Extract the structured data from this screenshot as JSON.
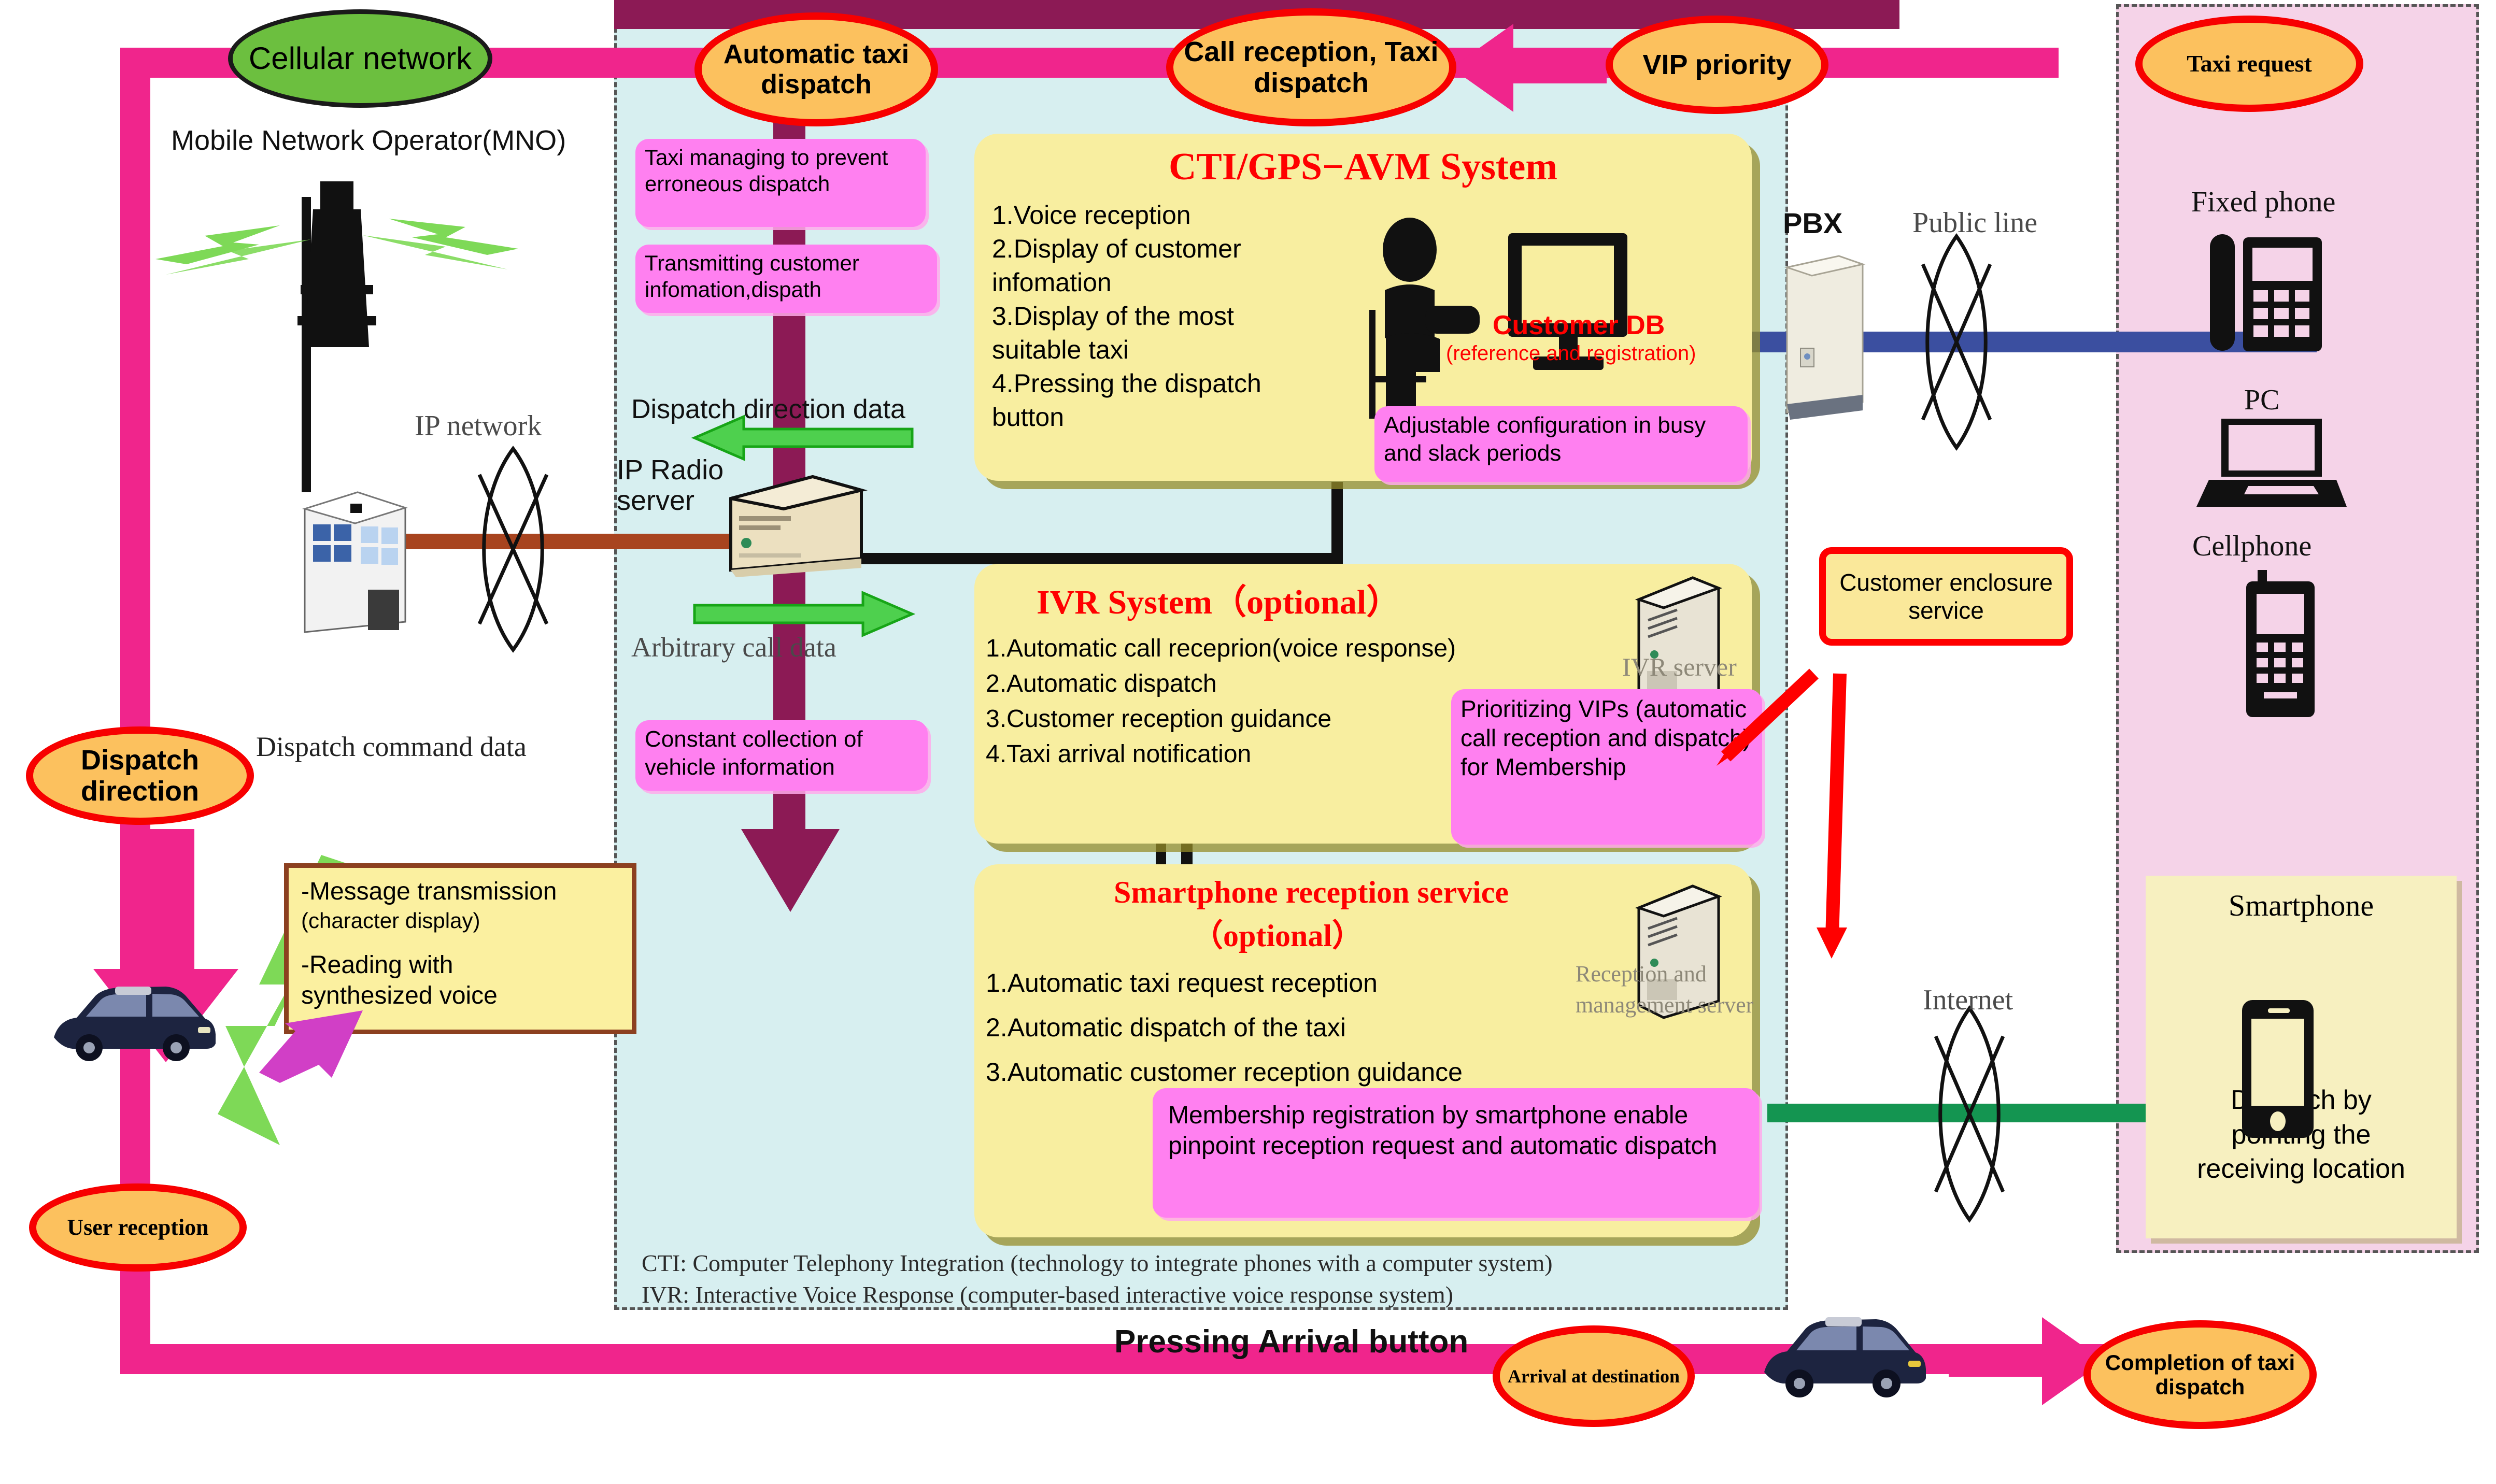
{
  "zones": {
    "center_label": "",
    "right_label": ""
  },
  "callouts": {
    "cellular_network": "Cellular network",
    "automatic_taxi_dispatch": "Automatic taxi dispatch",
    "call_reception_taxi_dispatch": "Call reception, Taxi dispatch",
    "vip_priority": "VIP priority",
    "taxi_request": "Taxi request",
    "dispatch_direction": "Dispatch direction",
    "user_reception": "User reception",
    "arrival_at_destination": "Arrival at destination",
    "completion_of_taxi_dispatch": "Completion of taxi dispatch",
    "customer_enclosure_service": "Customer enclosure service"
  },
  "labels": {
    "mno": "Mobile Network Operator(MNO)",
    "ip_network": "IP network",
    "ip_radio_server": "IP Radio server",
    "dispatch_direction_data": "Dispatch direction data",
    "arbitrary_call_data": "Arbitrary call data",
    "dispatch_command_data": "Dispatch command data",
    "pbx": "PBX",
    "public_line": "Public line",
    "internet": "Internet",
    "fixed_phone": "Fixed phone",
    "pc": "PC",
    "cellphone": "Cellphone",
    "ivr_server": "IVR server",
    "reception_management_server_line1": "Reception and",
    "reception_management_server_line2": "management server",
    "pressing_arrival_button": "Pressing Arrival button"
  },
  "notes": {
    "taxi_managing": "Taxi managing to prevent erroneous dispatch",
    "transmitting_customer": "Transmitting customer infomation,dispath",
    "constant_collection": "Constant collection of vehicle information",
    "adjustable_configuration": "Adjustable configuration in busy and slack periods",
    "prioritizing_vips": "Prioritizing VIPs (automatic call reception and dispatch) for Membership",
    "membership_registration": "Membership registration by smartphone enable pinpoint reception request and automatic dispatch"
  },
  "taxi_device_box": {
    "line1": "-Message transmission",
    "line2": "(character display)",
    "line3": "-Reading with",
    "line4": "   synthesized voice"
  },
  "cti_panel": {
    "title": "CTI/GPS−AVM System",
    "items": [
      "1.Voice reception",
      "2.Display of customer",
      "   infomation",
      "3.Display of the most",
      "   suitable taxi",
      "4.Pressing the dispatch",
      "   button"
    ],
    "customer_db": "Customer DB",
    "customer_db_sub": "(reference and registration)"
  },
  "ivr_panel": {
    "title": "IVR System（optional）",
    "items": [
      "1.Automatic call receprion(voice response)",
      "2.Automatic dispatch",
      "3.Customer reception guidance",
      "4.Taxi arrival notification"
    ]
  },
  "smartphone_panel": {
    "title_line1": "Smartphone reception service",
    "title_line2": "（optional）",
    "items": [
      "1.Automatic taxi request reception",
      "2.Automatic dispatch of the taxi",
      "3.Automatic customer reception guidance"
    ]
  },
  "smartphone_box": {
    "title": "Smartphone",
    "caption_line1": "Dispatch by",
    "caption_line2": "pointing  the",
    "caption_line3": "receiving location"
  },
  "footnotes": {
    "cti": "CTI: Computer Telephony Integration (technology to integrate phones with a computer system)",
    "ivr": "IVR: Interactive Voice Response (computer-based interactive voice response system)"
  },
  "colors": {
    "pink_line": "#f0258c",
    "dark_magenta": "#8c1a55",
    "blue_line": "#3b4fa0",
    "green_line": "#149551",
    "brown_line": "#a8441f",
    "center_zone": "#d7eff0",
    "right_zone": "#f5d3e8",
    "yellow_panel": "#f8eea0",
    "magenta_note": "#ff80f0",
    "ellipse_fill": "#fcc15e",
    "ellipse_border": "#f70000",
    "title_red": "#ff0000",
    "green_ellipse": "#6cbf3f"
  },
  "icons": {
    "cell_tower": "cell-tower-icon",
    "building": "building-icon",
    "server": "server-icon",
    "operator": "operator-person-icon",
    "monitor": "monitor-icon",
    "pbx_cabinet": "pbx-cabinet-icon",
    "network_cloud": "network-lens-icon",
    "fixed_phone": "desk-phone-icon",
    "laptop": "laptop-icon",
    "cellphone": "feature-phone-icon",
    "smartphone": "smartphone-icon",
    "taxi": "taxi-car-icon"
  }
}
